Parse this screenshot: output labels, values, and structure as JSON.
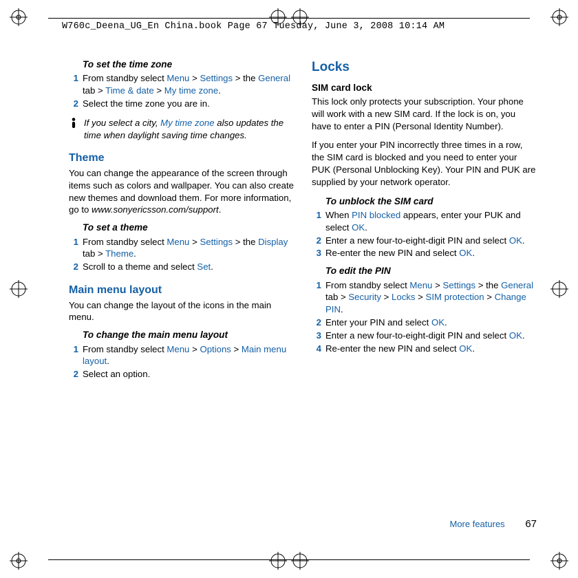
{
  "header": {
    "filepath": "W760c_Deena_UG_En China.book  Page 67  Tuesday, June 3, 2008  10:14 AM"
  },
  "left": {
    "timezone": {
      "heading": "To set the time zone",
      "steps": [
        {
          "pre": "From standby select ",
          "menu": "Menu",
          "gt1": " > ",
          "settings": "Settings",
          "gt2": " > the ",
          "tab": "General",
          "tab_suffix": " tab > ",
          "menu2": "Time & date",
          "gt3": " > ",
          "menu3": "My time zone",
          "post": "."
        },
        {
          "text": "Select the time zone you are in."
        }
      ],
      "note": {
        "pre": "If you select a city, ",
        "em": "My time zone",
        "post": " also updates the time when daylight saving time changes."
      }
    },
    "theme": {
      "heading": "Theme",
      "body_pre": "You can change the appearance of the screen through items such as colors and wallpaper. You can also create new themes and download them. For more information, go to ",
      "url": "www.sonyericsson.com/support",
      "body_post": ".",
      "sub": "To set a theme",
      "steps": [
        {
          "pre": "From standby select ",
          "menu": "Menu",
          "gt1": " > ",
          "settings": "Settings",
          "gt2": " > the ",
          "tab": "Display",
          "tab_suffix": " tab > ",
          "menu2": "Theme",
          "post": "."
        },
        {
          "pre": "Scroll to a theme and select ",
          "ok": "Set",
          "post": "."
        }
      ]
    },
    "mainmenu": {
      "heading": "Main menu layout",
      "body": "You can change the layout of the icons in the main menu.",
      "sub": "To change the main menu layout",
      "steps": [
        {
          "pre": "From standby select ",
          "menu": "Menu",
          "gt1": " > ",
          "opt": "Options",
          "gt2": " > ",
          "menu2": "Main menu layout",
          "post": "."
        },
        {
          "text": "Select an option."
        }
      ]
    }
  },
  "right": {
    "locks": {
      "heading": "Locks",
      "sim_heading": "SIM card lock",
      "p1": "This lock only protects your subscription. Your phone will work with a new SIM card. If the lock is on, you have to enter a PIN (Personal Identity Number).",
      "p2": "If you enter your PIN incorrectly three times in a row, the SIM card is blocked and you need to enter your PUK (Personal Unblocking Key). Your PIN and PUK are supplied by your network operator.",
      "unblock_heading": "To unblock the SIM card",
      "unblock_steps": [
        {
          "pre": "When ",
          "pin": "PIN blocked",
          "mid": " appears, enter your PUK and select ",
          "ok": "OK",
          "post": "."
        },
        {
          "pre": "Enter a new four-to-eight-digit PIN and select ",
          "ok": "OK",
          "post": "."
        },
        {
          "pre": "Re-enter the new PIN and select ",
          "ok": "OK",
          "post": "."
        }
      ],
      "edit_heading": "To edit the PIN",
      "edit_steps": [
        {
          "pre": "From standby select ",
          "menu": "Menu",
          "gt1": " > ",
          "settings": "Settings",
          "gt2": " > the ",
          "tab": "General",
          "tab_suffix": " tab > ",
          "sec": "Security",
          "gt3": " > ",
          "locks": "Locks",
          "gt4": " > ",
          "sim": "SIM protection",
          "gt5": " > ",
          "chg": "Change PIN",
          "post": "."
        },
        {
          "pre": "Enter your PIN and select ",
          "ok": "OK",
          "post": "."
        },
        {
          "pre": "Enter a new four-to-eight-digit PIN and select ",
          "ok": "OK",
          "post": "."
        },
        {
          "pre": "Re-enter the new PIN and select ",
          "ok": "OK",
          "post": "."
        }
      ]
    }
  },
  "footer": {
    "section": "More features",
    "page": "67"
  },
  "nums": [
    "1",
    "2",
    "3",
    "4"
  ]
}
